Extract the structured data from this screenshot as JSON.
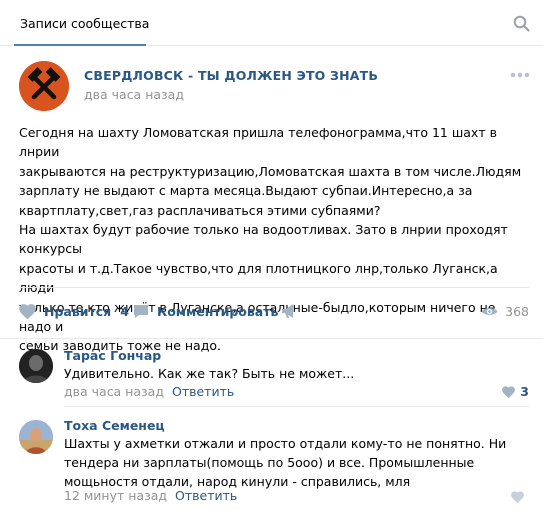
{
  "tabs": {
    "active_label": "Записи сообщества"
  },
  "post": {
    "group_name": "СВЕРДЛОВСК - ТЫ ДОЛЖЕН ЭТО ЗНАТЬ",
    "time": "два часа назад",
    "text": "Сегодня на шахту Ломоватская пришла телефонограмма,что 11 шахт в лнрии\nзакрываются на реструктуризацию,Ломоватская шахта в том числе.Людям\nзарплату не выдают с марта месяца.Выдают субпаи.Интересно,а за\nквартплату,свет,газ расплачиваться этими субпаями?\nНа шахтах будут рабочие только на водоотливах. Зато в лнрии проходят конкурсы\nкрасоты и т.д.Такое чувство,что для плотницкого лнр,только Луганск,а люди\nтолько те,кто живёт в Луганске,а остальные-быдло,которым ничего не надо и\nсемьи заводить тоже не надо.",
    "actions": {
      "like_label": "Нравится",
      "like_count": "4",
      "comment_label": "Комментировать",
      "views": "368"
    }
  },
  "comments": [
    {
      "author": "Тарас Гончар",
      "text": "Удивительно. Как же так? Быть не может...",
      "time": "два часа назад",
      "reply_label": "Ответить",
      "likes": "3"
    },
    {
      "author": "Тоха Семенец",
      "text": "Шахты у ахметки отжали и просто отдали кому-то не понятно. Ни тендера ни зарплаты(помощь по 5ооо) и все. Промышленные мощьностя отдали, народ кинули - справились, мля",
      "time": "12 минут назад",
      "reply_label": "Ответить",
      "likes": ""
    }
  ],
  "colors": {
    "link": "#2a5885",
    "muted": "#939393",
    "accent": "#5181b8",
    "divider": "#e7e8ec",
    "avatar_orange": "#d9531e"
  },
  "icons": [
    "search-icon",
    "more-icon",
    "heart-icon",
    "comment-icon",
    "share-icon",
    "eye-icon",
    "hammer-pick-logo"
  ]
}
